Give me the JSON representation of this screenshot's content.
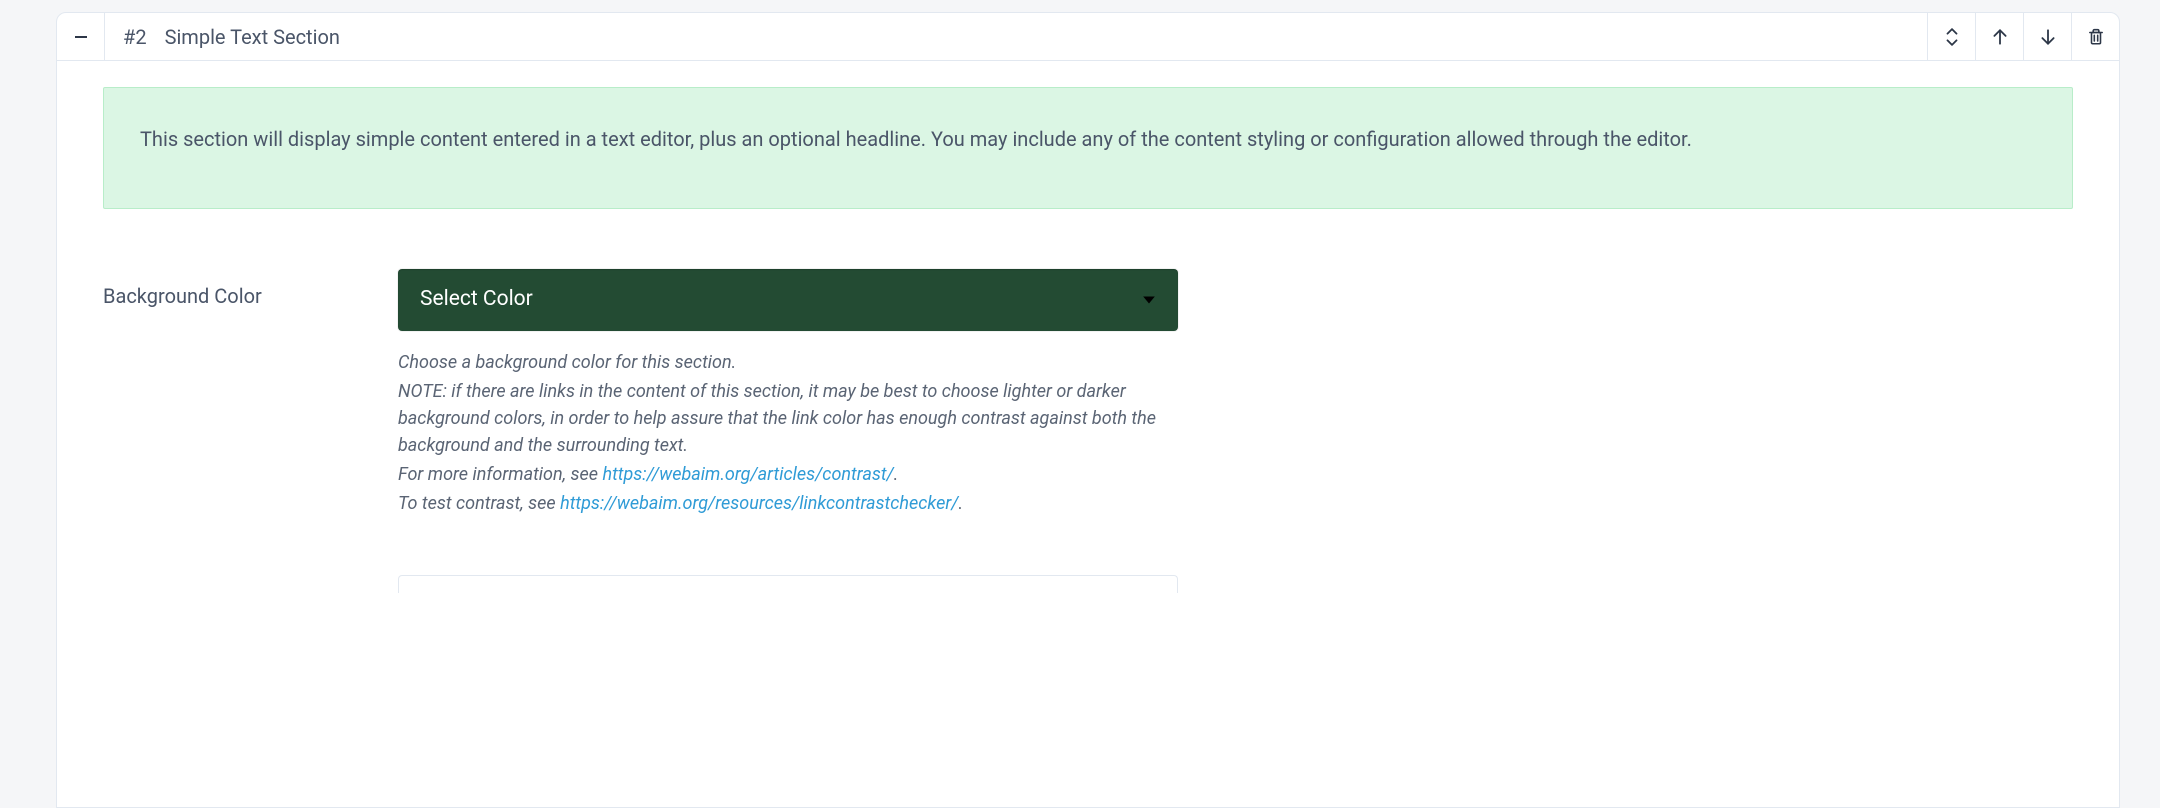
{
  "header": {
    "index": "#2",
    "title": "Simple Text Section"
  },
  "info": "This section will display simple content entered in a text editor, plus an optional headline. You may include any of the content styling or configuration allowed through the editor.",
  "field": {
    "label": "Background Color",
    "selected": "Select Color",
    "help": {
      "line1": "Choose a background color for this section.",
      "note": "NOTE: if there are links in the content of this section, it may be best to choose lighter or darker background colors, in order to help assure that the link color has enough contrast against both the background and the surrounding text.",
      "more_prefix": "For more information, see ",
      "more_link": "https://webaim.org/articles/contrast/",
      "more_suffix": ".",
      "test_prefix": "To test contrast, see ",
      "test_link": "https://webaim.org/resources/linkcontrastchecker/",
      "test_suffix": "."
    }
  }
}
